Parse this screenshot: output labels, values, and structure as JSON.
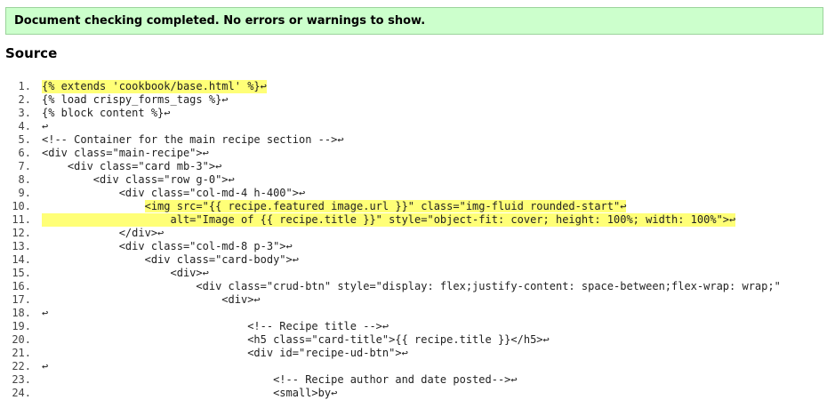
{
  "status_message": "Document checking completed. No errors or warnings to show.",
  "section_title": "Source",
  "source_lines": [
    {
      "n": "1.",
      "text": "{% extends 'cookbook/base.html' %}↩",
      "highlight": true
    },
    {
      "n": "2.",
      "text": "{% load crispy_forms_tags %}↩",
      "highlight": false
    },
    {
      "n": "3.",
      "text": "{% block content %}↩",
      "highlight": false
    },
    {
      "n": "4.",
      "text": "↩",
      "highlight": false
    },
    {
      "n": "5.",
      "text": "<!-- Container for the main recipe section -->↩",
      "highlight": false
    },
    {
      "n": "6.",
      "text": "<div class=\"main-recipe\">↩",
      "highlight": false
    },
    {
      "n": "7.",
      "text": "    <div class=\"card mb-3\">↩",
      "highlight": false
    },
    {
      "n": "8.",
      "text": "        <div class=\"row g-0\">↩",
      "highlight": false
    },
    {
      "n": "9.",
      "text": "            <div class=\"col-md-4 h-400\">↩",
      "highlight": false
    },
    {
      "n": "10.",
      "text": "                <img src=\"{{ recipe.featured image.url }}\" class=\"img-fluid rounded-start\"↩",
      "highlight": "partial"
    },
    {
      "n": "11.",
      "text": "                    alt=\"Image of {{ recipe.title }}\" style=\"object-fit: cover; height: 100%; width: 100%\">↩",
      "highlight": true
    },
    {
      "n": "12.",
      "text": "            </div>↩",
      "highlight": false
    },
    {
      "n": "13.",
      "text": "            <div class=\"col-md-8 p-3\">↩",
      "highlight": false
    },
    {
      "n": "14.",
      "text": "                <div class=\"card-body\">↩",
      "highlight": false
    },
    {
      "n": "15.",
      "text": "                    <div>↩",
      "highlight": false
    },
    {
      "n": "16.",
      "text": "                        <div class=\"crud-btn\" style=\"display: flex;justify-content: space-between;flex-wrap: wrap;\"",
      "highlight": false
    },
    {
      "n": "17.",
      "text": "                            <div>↩",
      "highlight": false
    },
    {
      "n": "18.",
      "text": "↩",
      "highlight": false
    },
    {
      "n": "19.",
      "text": "                                <!-- Recipe title -->↩",
      "highlight": false
    },
    {
      "n": "20.",
      "text": "                                <h5 class=\"card-title\">{{ recipe.title }}</h5>↩",
      "highlight": false
    },
    {
      "n": "21.",
      "text": "                                <div id=\"recipe-ud-btn\">↩",
      "highlight": false
    },
    {
      "n": "22.",
      "text": "↩",
      "highlight": false
    },
    {
      "n": "23.",
      "text": "                                    <!-- Recipe author and date posted-->↩",
      "highlight": false
    },
    {
      "n": "24.",
      "text": "                                    <small>by↩",
      "highlight": false
    }
  ],
  "colors": {
    "banner_bg": "#ccffcc",
    "highlight": "#ffff77"
  }
}
